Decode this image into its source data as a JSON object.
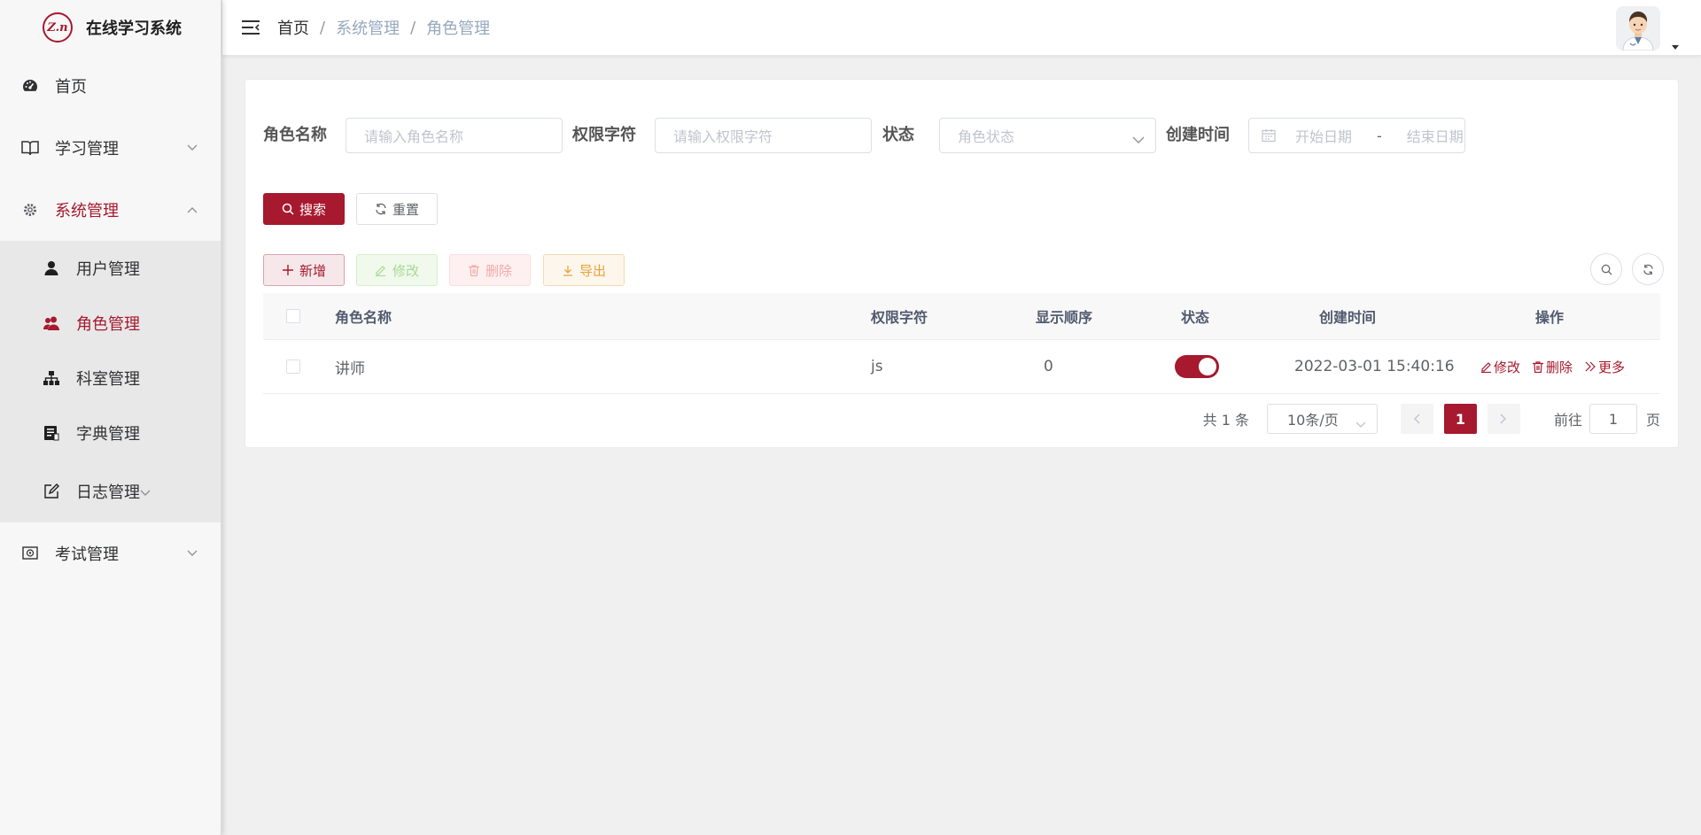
{
  "app": {
    "title": "在线学习系统",
    "logo_text": "Z.n"
  },
  "sidebar": {
    "items": [
      {
        "label": "首页"
      },
      {
        "label": "学习管理"
      },
      {
        "label": "系统管理"
      },
      {
        "label": "考试管理"
      }
    ],
    "sub_items": [
      {
        "label": "用户管理"
      },
      {
        "label": "角色管理"
      },
      {
        "label": "科室管理"
      },
      {
        "label": "字典管理"
      },
      {
        "label": "日志管理"
      }
    ]
  },
  "breadcrumb": {
    "home": "首页",
    "sep": "/",
    "level1": "系统管理",
    "level2": "角色管理"
  },
  "search": {
    "role_name_label": "角色名称",
    "role_name_placeholder": "请输入角色名称",
    "perm_label": "权限字符",
    "perm_placeholder": "请输入权限字符",
    "status_label": "状态",
    "status_placeholder": "角色状态",
    "created_label": "创建时间",
    "start_placeholder": "开始日期",
    "date_sep": "-",
    "end_placeholder": "结束日期",
    "search_button": "搜索",
    "reset_button": "重置"
  },
  "toolbar": {
    "add": "新增",
    "edit": "修改",
    "delete": "删除",
    "export": "导出"
  },
  "table": {
    "columns": [
      "角色名称",
      "权限字符",
      "显示顺序",
      "状态",
      "创建时间",
      "操作"
    ],
    "rows": [
      {
        "name": "讲师",
        "perm": "js",
        "order": "0",
        "status_on": true,
        "created": "2022-03-01 15:40:16"
      }
    ],
    "row_actions": {
      "edit": "修改",
      "delete": "删除",
      "more": "更多"
    }
  },
  "pagination": {
    "total": "共 1 条",
    "page_size": "10条/页",
    "current": "1",
    "goto_label": "前往",
    "goto_value": "1",
    "page_suffix": "页"
  },
  "colors": {
    "accent": "#a6192e"
  }
}
